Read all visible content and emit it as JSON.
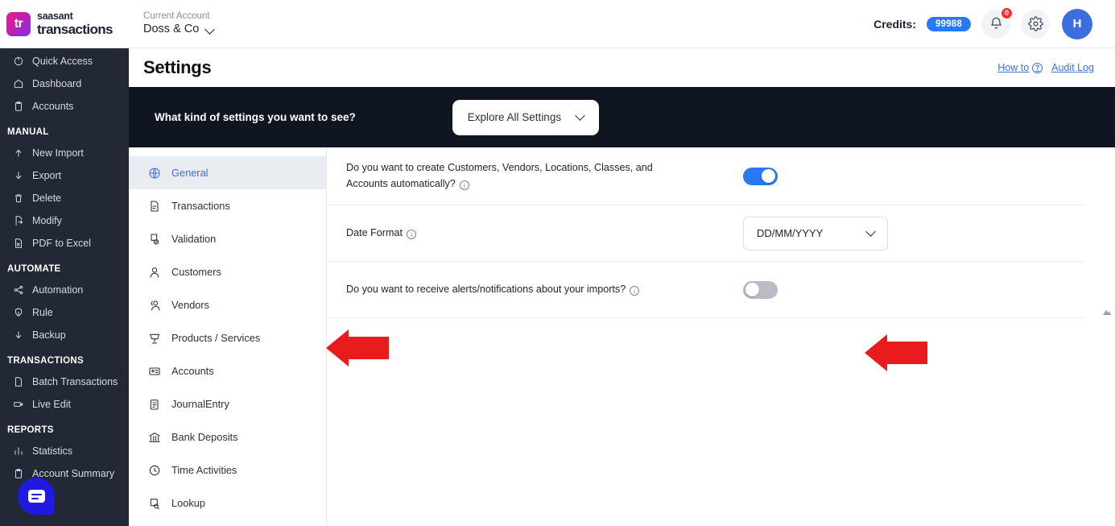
{
  "topbar": {
    "logo_mark_text": "tr",
    "logo_line1": "saasant",
    "logo_line2": "transactions",
    "account_caption": "Current Account",
    "account_name": "Doss & Co",
    "credits_label": "Credits:",
    "credits_value": "99988",
    "notification_badge": "0",
    "avatar_initial": "H",
    "icons": {
      "account_chevron": "chevron-down-icon",
      "bell": "bell-icon",
      "gear": "gear-icon"
    }
  },
  "sidebar": {
    "items": [
      {
        "label": "Quick Access",
        "icon": "target-icon",
        "type": "item"
      },
      {
        "label": "Dashboard",
        "icon": "home-icon",
        "type": "item"
      },
      {
        "label": "Accounts",
        "icon": "clipboard-icon",
        "type": "item"
      },
      {
        "label": "MANUAL",
        "type": "group"
      },
      {
        "label": "New Import",
        "icon": "upload-icon",
        "type": "item"
      },
      {
        "label": "Export",
        "icon": "download-icon",
        "type": "item"
      },
      {
        "label": "Delete",
        "icon": "trash-icon",
        "type": "item"
      },
      {
        "label": "Modify",
        "icon": "file-edit-icon",
        "type": "item"
      },
      {
        "label": "PDF to Excel",
        "icon": "pdf-file-icon",
        "type": "item"
      },
      {
        "label": "AUTOMATE",
        "type": "group"
      },
      {
        "label": "Automation",
        "icon": "share-nodes-icon",
        "type": "item"
      },
      {
        "label": "Rule",
        "icon": "rule-icon",
        "type": "item"
      },
      {
        "label": "Backup",
        "icon": "download-icon",
        "type": "item"
      },
      {
        "label": "TRANSACTIONS",
        "type": "group"
      },
      {
        "label": "Batch Transactions",
        "icon": "file-icon",
        "type": "item"
      },
      {
        "label": "Live Edit",
        "icon": "live-edit-icon",
        "type": "item"
      },
      {
        "label": "REPORTS",
        "type": "group"
      },
      {
        "label": "Statistics",
        "icon": "chart-icon",
        "type": "item"
      },
      {
        "label": "Account Summary",
        "icon": "clipboard-icon",
        "type": "item"
      }
    ]
  },
  "page": {
    "title": "Settings",
    "how_to_label": "How to",
    "how_to_icon": "question-mark-icon",
    "audit_log_label": "Audit Log"
  },
  "filter": {
    "question": "What kind of settings you want to see?",
    "selected": "Explore All Settings",
    "chevron_icon": "chevron-down-icon"
  },
  "tabs": [
    {
      "label": "General",
      "icon": "globe-icon",
      "active": true
    },
    {
      "label": "Transactions",
      "icon": "document-icon",
      "active": false
    },
    {
      "label": "Validation",
      "icon": "document-check-icon",
      "active": false
    },
    {
      "label": "Customers",
      "icon": "user-icon",
      "active": false
    },
    {
      "label": "Vendors",
      "icon": "users-icon",
      "active": false
    },
    {
      "label": "Products / Services",
      "icon": "cart-icon",
      "active": false
    },
    {
      "label": "Accounts",
      "icon": "id-card-icon",
      "active": false
    },
    {
      "label": "JournalEntry",
      "icon": "journal-icon",
      "active": false
    },
    {
      "label": "Bank Deposits",
      "icon": "bank-icon",
      "active": false
    },
    {
      "label": "Time Activities",
      "icon": "clock-icon",
      "active": false
    },
    {
      "label": "Lookup",
      "icon": "lookup-icon",
      "active": false
    }
  ],
  "settings_rows": {
    "auto_create": {
      "label": "Do you want to create Customers, Vendors, Locations, Classes, and Accounts automatically?",
      "info_icon": "info-icon",
      "toggle_state": "on"
    },
    "date_format": {
      "label": "Date Format",
      "info_icon": "info-icon",
      "value": "DD/MM/YYYY",
      "chevron_icon": "chevron-down-icon"
    },
    "alerts": {
      "label": "Do you want to receive alerts/notifications about your imports?",
      "info_icon": "info-icon",
      "toggle_state": "off"
    }
  },
  "annotations": {
    "arrow_color": "#e81c1c",
    "arrow_general_tab": "red-arrow-pointing-to-general-tab",
    "arrow_date_format": "red-arrow-pointing-to-date-format-dropdown"
  },
  "chat_widget": {
    "icon": "chat-bubble-icon",
    "color": "#2019e0"
  },
  "colors": {
    "sidebar_bg": "#232836",
    "filterbar_bg": "#101522",
    "accent_blue": "#2979f5",
    "link_blue": "#3b6fe0",
    "toggle_on": "#2979f5",
    "toggle_off": "#b9bcc4"
  }
}
